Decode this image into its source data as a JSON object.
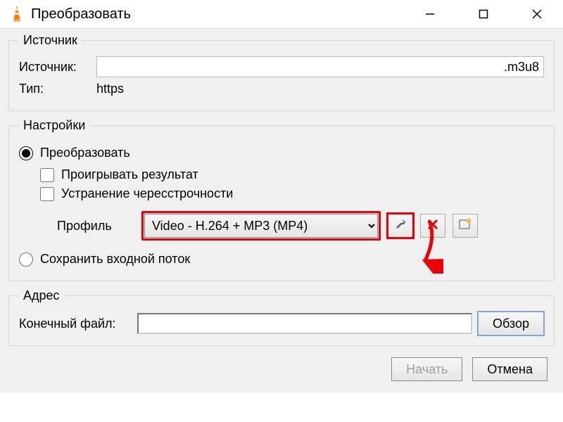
{
  "window": {
    "title": "Преобразовать"
  },
  "source": {
    "legend": "Источник",
    "source_label": "Источник:",
    "source_value": ".m3u8",
    "type_label": "Тип:",
    "type_value": "https"
  },
  "settings": {
    "legend": "Настройки",
    "convert_label": "Преобразовать",
    "play_result_label": "Проигрывать результат",
    "deinterlace_label": "Устранение чересстрочности",
    "profile_label": "Профиль",
    "profile_value": "Video - H.264 + MP3 (MP4)",
    "save_stream_label": "Сохранить входной поток"
  },
  "destination": {
    "legend": "Адрес",
    "file_label": "Конечный файл:",
    "file_value": "",
    "browse_label": "Обзор"
  },
  "footer": {
    "start_label": "Начать",
    "cancel_label": "Отмена"
  }
}
